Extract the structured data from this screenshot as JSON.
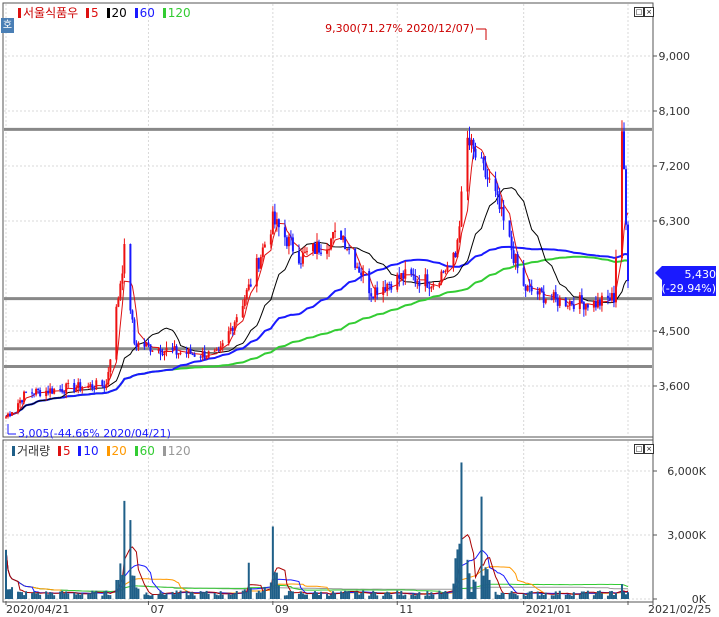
{
  "price_legend": {
    "name": "서울식품우",
    "items": [
      {
        "label": "5",
        "color": "#dd1111"
      },
      {
        "label": "20",
        "color": "#000000"
      },
      {
        "label": "60",
        "color": "#1a1aff"
      },
      {
        "label": "120",
        "color": "#33cc33"
      }
    ]
  },
  "volume_legend": {
    "name": "거래량",
    "items": [
      {
        "label": "5",
        "color": "#dd1111"
      },
      {
        "label": "10",
        "color": "#1a1aff"
      },
      {
        "label": "20",
        "color": "#ff9900"
      },
      {
        "label": "60",
        "color": "#33cc33"
      },
      {
        "label": "120",
        "color": "#999999"
      }
    ]
  },
  "badge_text": "호",
  "colors": {
    "up": "#ee1111",
    "down": "#1a1aff",
    "ma5": "#dd1111",
    "ma20": "#000000",
    "ma60": "#1a1aff",
    "ma120": "#33cc33",
    "volume_bar": "#1f5f88",
    "level_line": "#888888"
  },
  "chart_data": [
    {
      "type": "candlestick",
      "title": "서울식품우",
      "y_ticks": [
        "9,000",
        "8,100",
        "7,200",
        "6,300",
        "4,500",
        "3,600"
      ],
      "y_tick_values": [
        9000,
        8100,
        7200,
        6300,
        4500,
        3600
      ],
      "ylim": [
        2950,
        10000
      ],
      "max_label": "9,300(71.27% 2020/12/07)",
      "min_label": "3,005(-44.66% 2020/04/21)",
      "current_price": "5,430",
      "current_change": "(-29.94%)",
      "horizontal_levels": [
        7800,
        5030,
        4210,
        3920
      ],
      "moving_averages": [
        "5",
        "20",
        "60",
        "120"
      ],
      "x_ticks": [
        "2020/04/21",
        "07",
        "09",
        "11",
        "2021/01",
        "2021/02/25"
      ],
      "x_tick_dates": [
        "2020-04-21",
        "2020-07-01",
        "2020-09-01",
        "2020-11-02",
        "2021-01-04",
        "2021-02-25"
      ],
      "series_keypoints": [
        {
          "date": "2020-04-21",
          "close": 3100
        },
        {
          "date": "2020-05-01",
          "close": 3480
        },
        {
          "date": "2020-05-20",
          "close": 3560
        },
        {
          "date": "2020-06-10",
          "close": 3620
        },
        {
          "date": "2020-06-19",
          "close": 5800
        },
        {
          "date": "2020-06-24",
          "close": 4300
        },
        {
          "date": "2020-07-15",
          "close": 4150
        },
        {
          "date": "2020-08-05",
          "close": 4100
        },
        {
          "date": "2020-08-20",
          "close": 5200
        },
        {
          "date": "2020-09-01",
          "close": 6300
        },
        {
          "date": "2020-09-15",
          "close": 5700
        },
        {
          "date": "2020-10-05",
          "close": 6100
        },
        {
          "date": "2020-10-20",
          "close": 5150
        },
        {
          "date": "2020-11-05",
          "close": 5400
        },
        {
          "date": "2020-11-20",
          "close": 5300
        },
        {
          "date": "2020-12-01",
          "close": 5700
        },
        {
          "date": "2020-12-07",
          "close": 7600
        },
        {
          "date": "2020-12-20",
          "close": 6800
        },
        {
          "date": "2021-01-04",
          "close": 5200
        },
        {
          "date": "2021-01-20",
          "close": 5000
        },
        {
          "date": "2021-02-10",
          "close": 4950
        },
        {
          "date": "2021-02-18",
          "close": 5050
        },
        {
          "date": "2021-02-22",
          "close": 7800
        },
        {
          "date": "2021-02-25",
          "close": 5430
        }
      ]
    },
    {
      "type": "bar",
      "title": "거래량",
      "y_ticks": [
        "6,000K",
        "3,000K",
        "0K"
      ],
      "y_tick_values": [
        6000,
        3000,
        0
      ],
      "ylim": [
        0,
        7000
      ],
      "volume_spikes": [
        {
          "date": "2020-04-21",
          "value": 2300
        },
        {
          "date": "2020-06-19",
          "value": 4600
        },
        {
          "date": "2020-06-22",
          "value": 3700
        },
        {
          "date": "2020-08-20",
          "value": 1700
        },
        {
          "date": "2020-09-01",
          "value": 3400
        },
        {
          "date": "2020-12-04",
          "value": 6400
        },
        {
          "date": "2020-12-14",
          "value": 4800
        },
        {
          "date": "2021-02-22",
          "value": 700
        }
      ]
    }
  ]
}
